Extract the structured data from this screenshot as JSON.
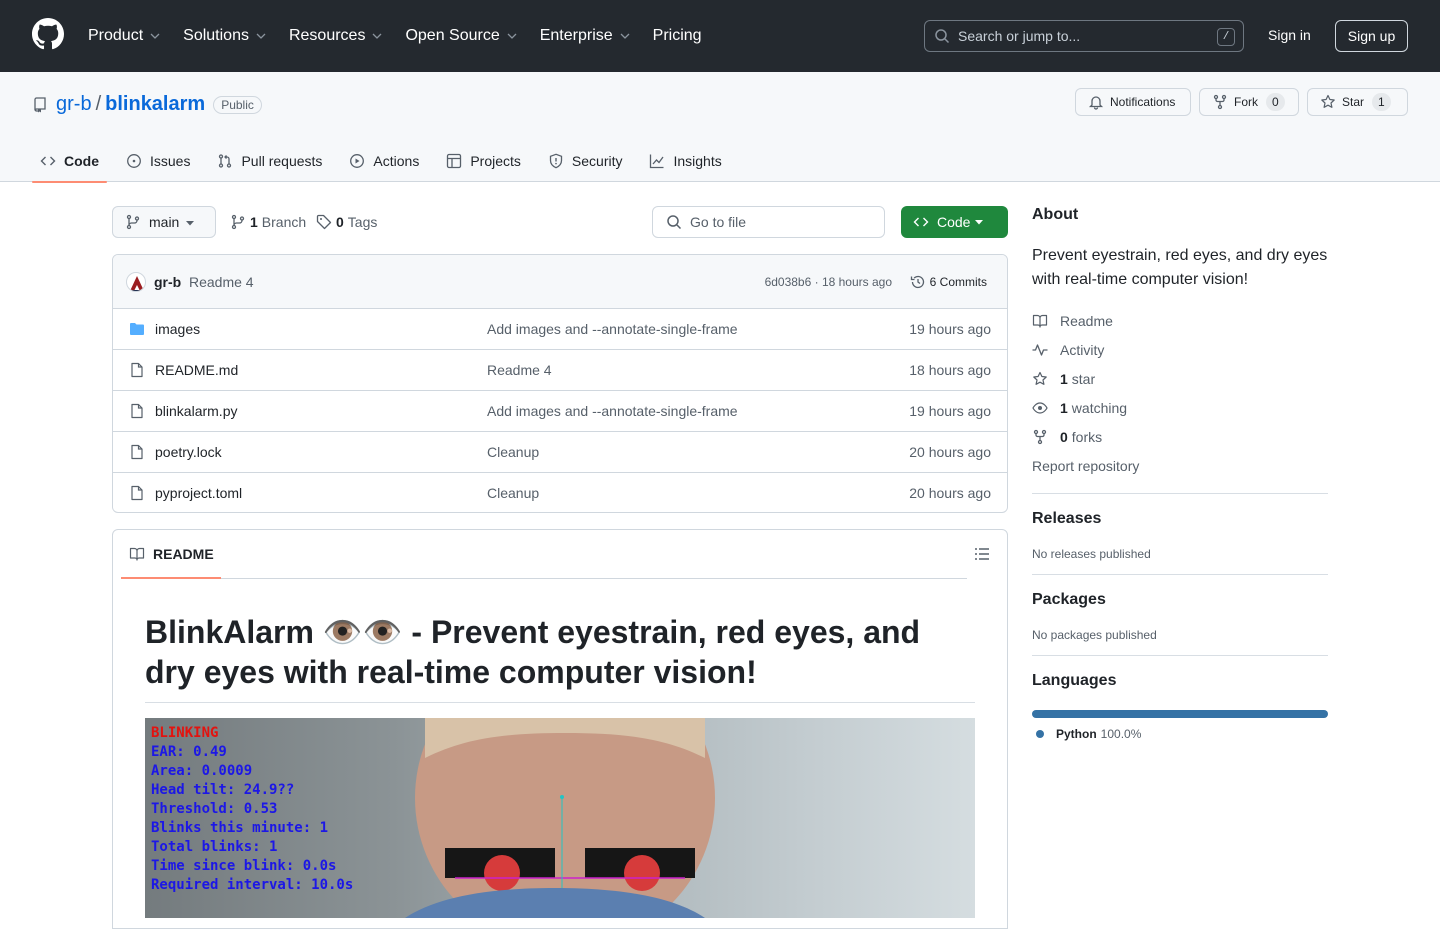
{
  "header": {
    "nav": [
      "Product",
      "Solutions",
      "Resources",
      "Open Source",
      "Enterprise",
      "Pricing"
    ],
    "search_placeholder": "Search or jump to...",
    "search_shortcut": "/",
    "sign_in": "Sign in",
    "sign_up": "Sign up"
  },
  "repo": {
    "owner": "gr-b",
    "separator": "/",
    "name": "blinkalarm",
    "visibility": "Public",
    "notifications": "Notifications",
    "fork_label": "Fork",
    "fork_count": "0",
    "star_label": "Star",
    "star_count": "1"
  },
  "tabs": [
    "Code",
    "Issues",
    "Pull requests",
    "Actions",
    "Projects",
    "Security",
    "Insights"
  ],
  "toolbar": {
    "branch": "main",
    "branch_count": "1",
    "branch_label": "Branch",
    "tag_count": "0",
    "tag_label": "Tags",
    "goto_file": "Go to file",
    "code_button": "Code"
  },
  "commit": {
    "author": "gr-b",
    "message": "Readme 4",
    "hash": "6d038b6 · 18 hours ago",
    "commits": "6 Commits"
  },
  "files": [
    {
      "name": "images",
      "type": "dir",
      "message": "Add images and --annotate-single-frame",
      "time": "19 hours ago"
    },
    {
      "name": "README.md",
      "type": "file",
      "message": "Readme 4",
      "time": "18 hours ago"
    },
    {
      "name": "blinkalarm.py",
      "type": "file",
      "message": "Add images and --annotate-single-frame",
      "time": "19 hours ago"
    },
    {
      "name": "poetry.lock",
      "type": "file",
      "message": "Cleanup",
      "time": "20 hours ago"
    },
    {
      "name": "pyproject.toml",
      "type": "file",
      "message": "Cleanup",
      "time": "20 hours ago"
    }
  ],
  "readme": {
    "tab": "README",
    "title": "BlinkAlarm 👁️👁️ - Prevent eyestrain, red eyes, and dry eyes with real-time computer vision!",
    "overlay": [
      {
        "text": "BLINKING",
        "color": "#e3130f"
      },
      {
        "text": "EAR: 0.49",
        "color": "#1c17e6"
      },
      {
        "text": "Area: 0.0009",
        "color": "#1c17e6"
      },
      {
        "text": "Head tilt: 24.9??",
        "color": "#1c17e6"
      },
      {
        "text": "Threshold: 0.53",
        "color": "#1c17e6"
      },
      {
        "text": "Blinks this minute: 1",
        "color": "#1c17e6"
      },
      {
        "text": "Total blinks: 1",
        "color": "#1c17e6"
      },
      {
        "text": "Time since blink: 0.0s",
        "color": "#1c17e6"
      },
      {
        "text": "Required interval: 10.0s",
        "color": "#1c17e6"
      }
    ]
  },
  "sidebar": {
    "about_title": "About",
    "about_desc": "Prevent eyestrain, red eyes, and dry eyes with real-time computer vision!",
    "readme": "Readme",
    "activity": "Activity",
    "stars_count": "1",
    "stars_label": "star",
    "watching_count": "1",
    "watching_label": "watching",
    "forks_count": "0",
    "forks_label": "forks",
    "report": "Report repository",
    "releases_title": "Releases",
    "releases_text": "No releases published",
    "packages_title": "Packages",
    "packages_text": "No packages published",
    "languages_title": "Languages",
    "language_name": "Python",
    "language_pct": "100.0%",
    "language_color": "#3572a5"
  }
}
